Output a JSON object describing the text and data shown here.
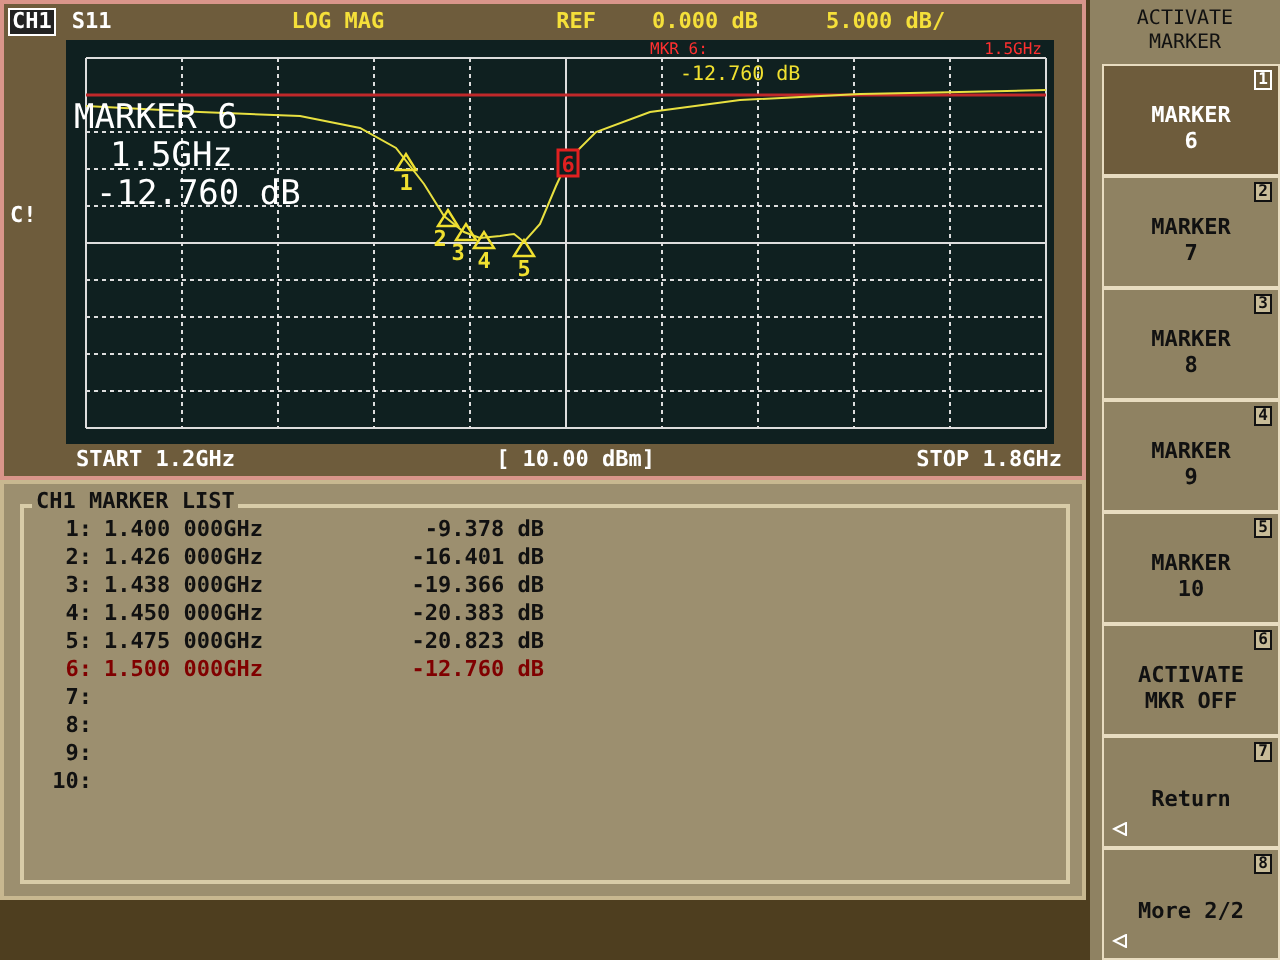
{
  "header": {
    "channel": "CH1",
    "parameter": "S11",
    "format": "LOG MAG",
    "ref_label": "REF",
    "ref_value": "0.000 dB",
    "scale": "5.000 dB/"
  },
  "display": {
    "readout_label": "MKR 6:",
    "readout_freq": "1.5GHz",
    "readout_value": "-12.760 dB",
    "big_title": "MARKER 6",
    "big_freq": "1.5GHz",
    "big_value": "-12.760 dB",
    "side_flag": "C!",
    "markers": [
      {
        "label": "1",
        "selected": false
      },
      {
        "label": "2",
        "selected": false
      },
      {
        "label": "3",
        "selected": false
      },
      {
        "label": "4",
        "selected": false
      },
      {
        "label": "5",
        "selected": false
      },
      {
        "label": "6",
        "selected": true
      }
    ]
  },
  "footer": {
    "start": "START 1.2GHz",
    "power": "[ 10.00 dBm]",
    "stop": "STOP 1.8GHz"
  },
  "marker_list": {
    "title": "CH1 MARKER LIST",
    "rows": [
      {
        "index": "1:",
        "frequency": "1.400 000GHz",
        "value": "-9.378 dB",
        "selected": false
      },
      {
        "index": "2:",
        "frequency": "1.426 000GHz",
        "value": "-16.401 dB",
        "selected": false
      },
      {
        "index": "3:",
        "frequency": "1.438 000GHz",
        "value": "-19.366 dB",
        "selected": false
      },
      {
        "index": "4:",
        "frequency": "1.450 000GHz",
        "value": "-20.383 dB",
        "selected": false
      },
      {
        "index": "5:",
        "frequency": "1.475 000GHz",
        "value": "-20.823 dB",
        "selected": false
      },
      {
        "index": "6:",
        "frequency": "1.500 000GHz",
        "value": "-12.760 dB",
        "selected": true
      },
      {
        "index": "7:",
        "selected": false
      },
      {
        "index": "8:",
        "selected": false
      },
      {
        "index": "9:",
        "selected": false
      },
      {
        "index": "10:",
        "selected": false
      }
    ]
  },
  "softkeys": {
    "title": [
      "ACTIVATE",
      "MARKER"
    ],
    "keys": [
      {
        "lines": [
          "MARKER",
          "6"
        ],
        "number": "1",
        "selected": true,
        "submenu": false
      },
      {
        "lines": [
          "MARKER",
          "7"
        ],
        "number": "2",
        "selected": false,
        "submenu": false
      },
      {
        "lines": [
          "MARKER",
          "8"
        ],
        "number": "3",
        "selected": false,
        "submenu": false
      },
      {
        "lines": [
          "MARKER",
          "9"
        ],
        "number": "4",
        "selected": false,
        "submenu": false
      },
      {
        "lines": [
          "MARKER",
          "10"
        ],
        "number": "5",
        "selected": false,
        "submenu": false
      },
      {
        "lines": [
          "ACTIVATE",
          "MKR OFF"
        ],
        "number": "6",
        "selected": false,
        "submenu": false
      },
      {
        "lines": [
          "Return"
        ],
        "number": "7",
        "selected": false,
        "submenu": true
      },
      {
        "lines": [
          "More 2/2"
        ],
        "number": "8",
        "selected": false,
        "submenu": true
      }
    ]
  }
}
